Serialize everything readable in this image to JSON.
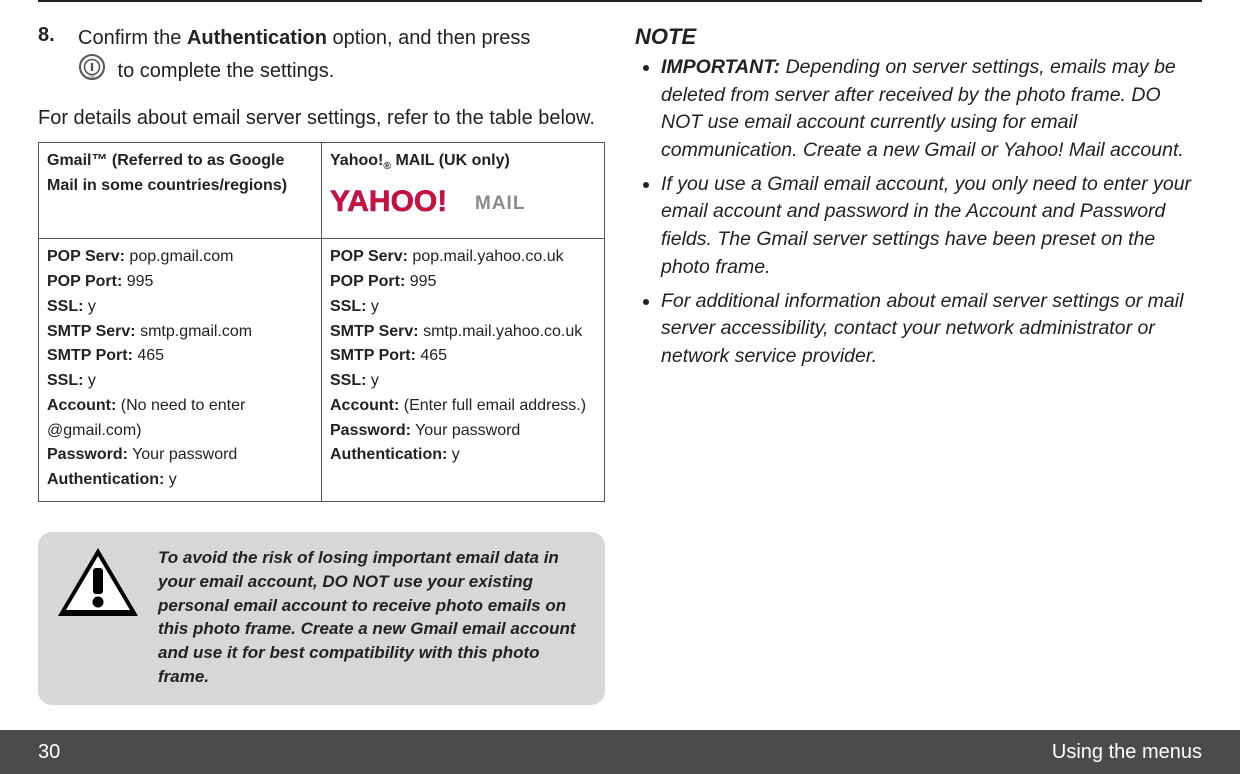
{
  "step": {
    "num": "8.",
    "text_before": "Confirm the ",
    "auth_word": "Authentication",
    "text_mid": " option, and then press ",
    "text_after": " to complete the settings."
  },
  "details_para": "For details about email server settings, refer to the table below.",
  "table": {
    "gmail_header_a": "Gmail™ (Referred to as Google",
    "gmail_header_b": "Mail in some countries/regions)",
    "yahoo_header_a": "Yahoo!",
    "yahoo_header_reg": "®",
    "yahoo_header_b": " MAIL (UK only)",
    "gmail": {
      "pop_serv_l": "POP Serv:",
      "pop_serv_v": " pop.gmail.com",
      "pop_port_l": "POP Port:",
      "pop_port_v": " 995",
      "ssl1_l": "SSL:",
      "ssl1_v": " y",
      "smtp_serv_l": "SMTP Serv:",
      "smtp_serv_v": " smtp.gmail.com",
      "smtp_port_l": "SMTP Port:",
      "smtp_port_v": " 465",
      "ssl2_l": "SSL:",
      "ssl2_v": " y",
      "acct_l": "Account:",
      "acct_v": " (No need to enter @gmail.com)",
      "pwd_l": "Password:",
      "pwd_v": " Your password",
      "auth_l": "Authentication:",
      "auth_v": " y"
    },
    "yahoo": {
      "pop_serv_l": "POP Serv:",
      "pop_serv_v": " pop.mail.yahoo.co.uk",
      "pop_port_l": "POP Port:",
      "pop_port_v": " 995",
      "ssl1_l": "SSL:",
      "ssl1_v": " y",
      "smtp_serv_l": "SMTP Serv:",
      "smtp_serv_v": " smtp.mail.yahoo.co.uk",
      "smtp_port_l": "SMTP Port:",
      "smtp_port_v": " 465",
      "ssl2_l": "SSL:",
      "ssl2_v": " y",
      "acct_l": "Account:",
      "acct_v": " (Enter full email address.)",
      "pwd_l": "Password:",
      "pwd_v": " Your password",
      "auth_l": "Authentication:",
      "auth_v": " y"
    }
  },
  "warning": "To avoid the risk of losing important email data in your email account, DO NOT use your existing personal email account to receive photo emails on this photo frame. Create a new Gmail email account and use it for best compatibility with this photo frame.",
  "note_title": "NOTE",
  "notes": {
    "n1_imp": "IMPORTANT:",
    "n1": " Depending on server settings, emails may be deleted from server after received by the photo frame. DO NOT use email account currently using for email communication. Create a new Gmail or Yahoo! Mail account.",
    "n2": "If you use a Gmail email account, you only need to enter your email account and password in the Account and Password fields. The Gmail server settings have been preset on the photo frame.",
    "n3": "For additional information about email server settings or mail server accessibility, contact your network administrator or network service provider."
  },
  "footer": {
    "page": "30",
    "section": "Using the menus"
  }
}
